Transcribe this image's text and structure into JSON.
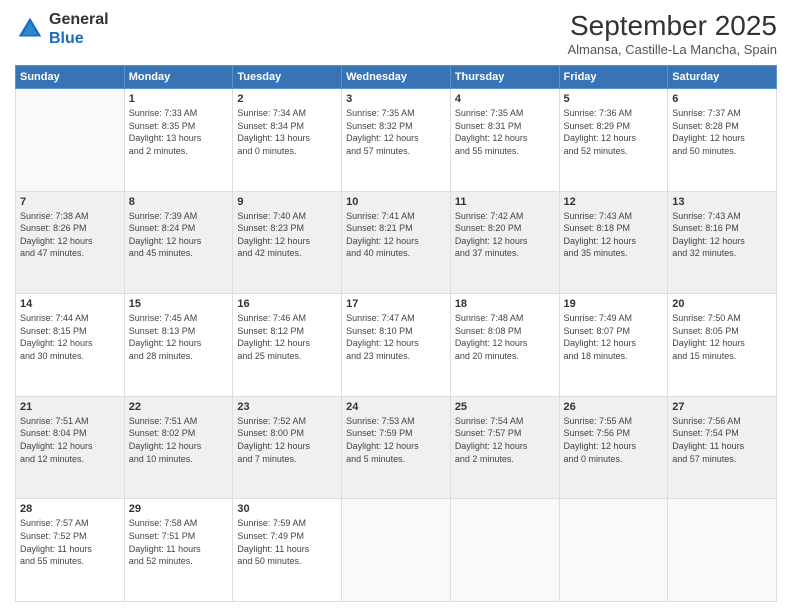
{
  "logo": {
    "general": "General",
    "blue": "Blue"
  },
  "header": {
    "month": "September 2025",
    "location": "Almansa, Castille-La Mancha, Spain"
  },
  "weekdays": [
    "Sunday",
    "Monday",
    "Tuesday",
    "Wednesday",
    "Thursday",
    "Friday",
    "Saturday"
  ],
  "weeks": [
    [
      {
        "day": "",
        "info": ""
      },
      {
        "day": "1",
        "info": "Sunrise: 7:33 AM\nSunset: 8:35 PM\nDaylight: 13 hours\nand 2 minutes."
      },
      {
        "day": "2",
        "info": "Sunrise: 7:34 AM\nSunset: 8:34 PM\nDaylight: 13 hours\nand 0 minutes."
      },
      {
        "day": "3",
        "info": "Sunrise: 7:35 AM\nSunset: 8:32 PM\nDaylight: 12 hours\nand 57 minutes."
      },
      {
        "day": "4",
        "info": "Sunrise: 7:35 AM\nSunset: 8:31 PM\nDaylight: 12 hours\nand 55 minutes."
      },
      {
        "day": "5",
        "info": "Sunrise: 7:36 AM\nSunset: 8:29 PM\nDaylight: 12 hours\nand 52 minutes."
      },
      {
        "day": "6",
        "info": "Sunrise: 7:37 AM\nSunset: 8:28 PM\nDaylight: 12 hours\nand 50 minutes."
      }
    ],
    [
      {
        "day": "7",
        "info": "Sunrise: 7:38 AM\nSunset: 8:26 PM\nDaylight: 12 hours\nand 47 minutes."
      },
      {
        "day": "8",
        "info": "Sunrise: 7:39 AM\nSunset: 8:24 PM\nDaylight: 12 hours\nand 45 minutes."
      },
      {
        "day": "9",
        "info": "Sunrise: 7:40 AM\nSunset: 8:23 PM\nDaylight: 12 hours\nand 42 minutes."
      },
      {
        "day": "10",
        "info": "Sunrise: 7:41 AM\nSunset: 8:21 PM\nDaylight: 12 hours\nand 40 minutes."
      },
      {
        "day": "11",
        "info": "Sunrise: 7:42 AM\nSunset: 8:20 PM\nDaylight: 12 hours\nand 37 minutes."
      },
      {
        "day": "12",
        "info": "Sunrise: 7:43 AM\nSunset: 8:18 PM\nDaylight: 12 hours\nand 35 minutes."
      },
      {
        "day": "13",
        "info": "Sunrise: 7:43 AM\nSunset: 8:16 PM\nDaylight: 12 hours\nand 32 minutes."
      }
    ],
    [
      {
        "day": "14",
        "info": "Sunrise: 7:44 AM\nSunset: 8:15 PM\nDaylight: 12 hours\nand 30 minutes."
      },
      {
        "day": "15",
        "info": "Sunrise: 7:45 AM\nSunset: 8:13 PM\nDaylight: 12 hours\nand 28 minutes."
      },
      {
        "day": "16",
        "info": "Sunrise: 7:46 AM\nSunset: 8:12 PM\nDaylight: 12 hours\nand 25 minutes."
      },
      {
        "day": "17",
        "info": "Sunrise: 7:47 AM\nSunset: 8:10 PM\nDaylight: 12 hours\nand 23 minutes."
      },
      {
        "day": "18",
        "info": "Sunrise: 7:48 AM\nSunset: 8:08 PM\nDaylight: 12 hours\nand 20 minutes."
      },
      {
        "day": "19",
        "info": "Sunrise: 7:49 AM\nSunset: 8:07 PM\nDaylight: 12 hours\nand 18 minutes."
      },
      {
        "day": "20",
        "info": "Sunrise: 7:50 AM\nSunset: 8:05 PM\nDaylight: 12 hours\nand 15 minutes."
      }
    ],
    [
      {
        "day": "21",
        "info": "Sunrise: 7:51 AM\nSunset: 8:04 PM\nDaylight: 12 hours\nand 12 minutes."
      },
      {
        "day": "22",
        "info": "Sunrise: 7:51 AM\nSunset: 8:02 PM\nDaylight: 12 hours\nand 10 minutes."
      },
      {
        "day": "23",
        "info": "Sunrise: 7:52 AM\nSunset: 8:00 PM\nDaylight: 12 hours\nand 7 minutes."
      },
      {
        "day": "24",
        "info": "Sunrise: 7:53 AM\nSunset: 7:59 PM\nDaylight: 12 hours\nand 5 minutes."
      },
      {
        "day": "25",
        "info": "Sunrise: 7:54 AM\nSunset: 7:57 PM\nDaylight: 12 hours\nand 2 minutes."
      },
      {
        "day": "26",
        "info": "Sunrise: 7:55 AM\nSunset: 7:56 PM\nDaylight: 12 hours\nand 0 minutes."
      },
      {
        "day": "27",
        "info": "Sunrise: 7:56 AM\nSunset: 7:54 PM\nDaylight: 11 hours\nand 57 minutes."
      }
    ],
    [
      {
        "day": "28",
        "info": "Sunrise: 7:57 AM\nSunset: 7:52 PM\nDaylight: 11 hours\nand 55 minutes."
      },
      {
        "day": "29",
        "info": "Sunrise: 7:58 AM\nSunset: 7:51 PM\nDaylight: 11 hours\nand 52 minutes."
      },
      {
        "day": "30",
        "info": "Sunrise: 7:59 AM\nSunset: 7:49 PM\nDaylight: 11 hours\nand 50 minutes."
      },
      {
        "day": "",
        "info": ""
      },
      {
        "day": "",
        "info": ""
      },
      {
        "day": "",
        "info": ""
      },
      {
        "day": "",
        "info": ""
      }
    ]
  ]
}
